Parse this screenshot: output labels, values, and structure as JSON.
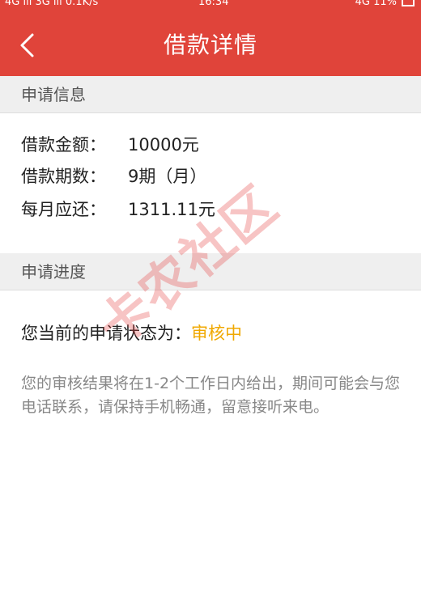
{
  "status_bar": {
    "left": "4G ıll 3G ıll 0.1K/s",
    "time": "16:34",
    "right": "4G 11%"
  },
  "header": {
    "title": "借款详情",
    "back_icon": "chevron-left-icon"
  },
  "sections": {
    "application_info": {
      "title": "申请信息",
      "rows": [
        {
          "label": "借款金额：",
          "value": "10000元"
        },
        {
          "label": "借款期数：",
          "value": "9期（月）"
        },
        {
          "label": "每月应还：",
          "value": "1311.11元"
        }
      ]
    },
    "application_progress": {
      "title": "申请进度",
      "status_label": "您当前的申请状态为：",
      "status_value": "审核中",
      "note": "您的审核结果将在1-2个工作日内给出，期间可能会与您电话联系，请保持手机畅通，留意接听来电。"
    }
  },
  "watermark": {
    "text": "卡农社区"
  },
  "colors": {
    "header_bg": "#e0443a",
    "status_value": "#f0a800",
    "section_bg": "#efefef"
  }
}
